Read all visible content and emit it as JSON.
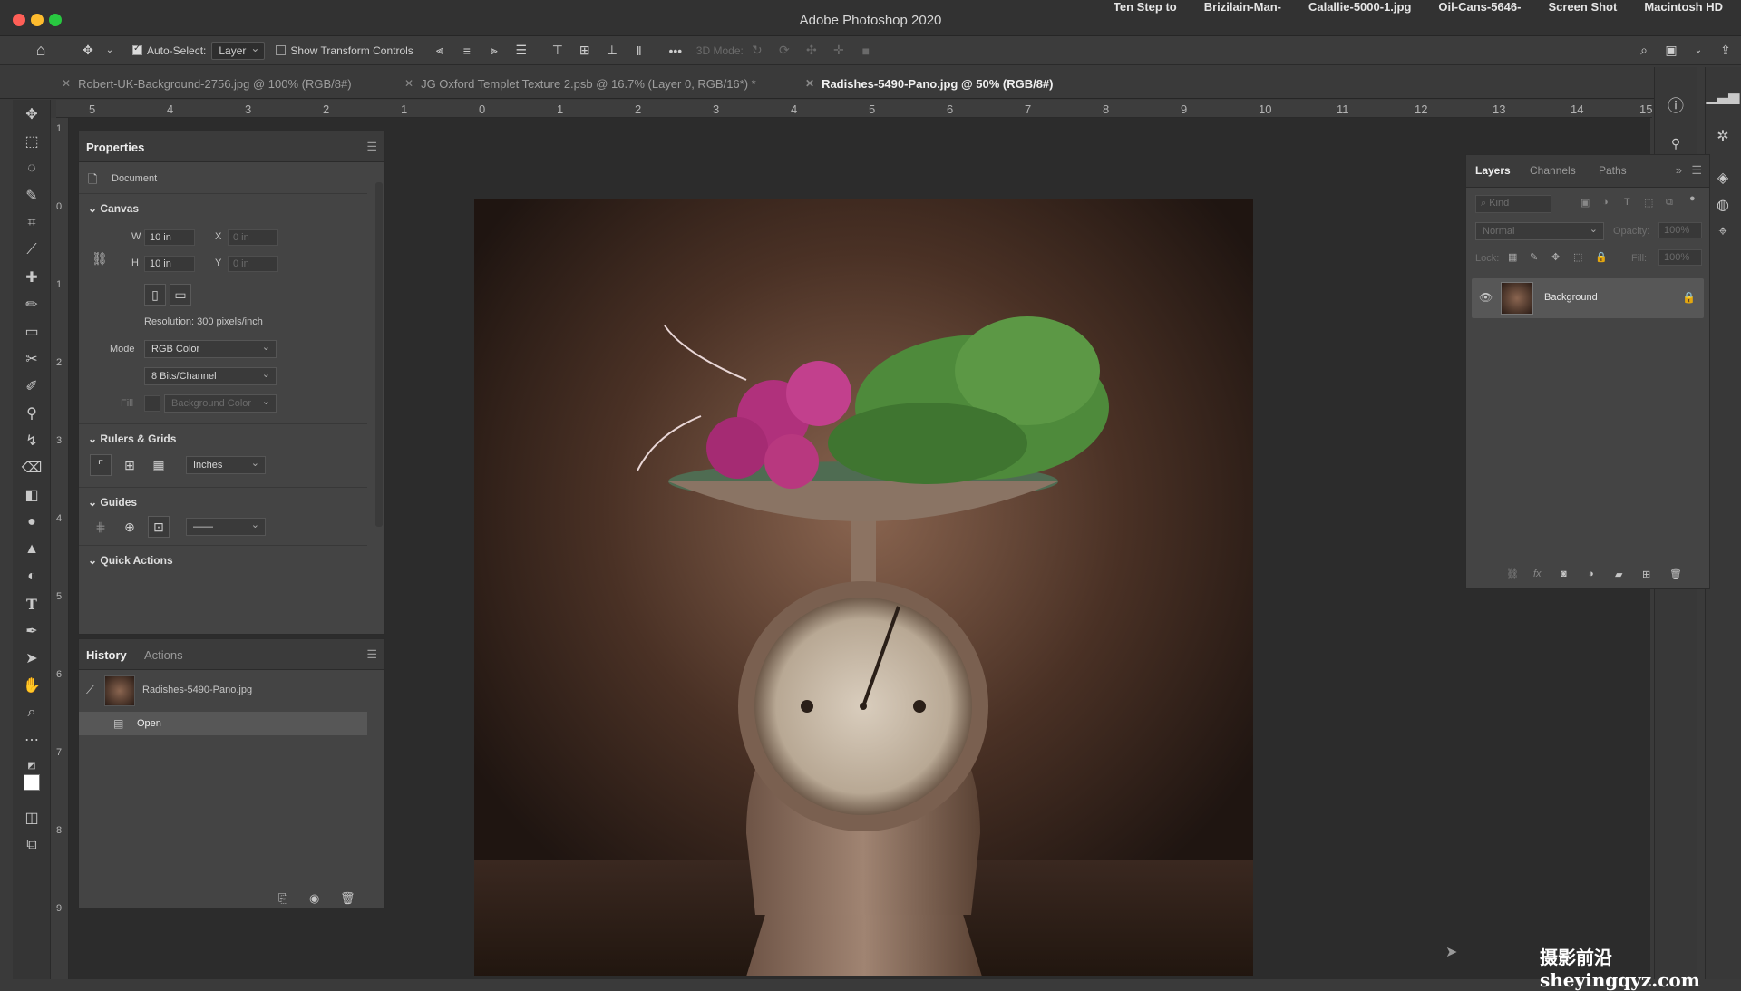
{
  "window": {
    "title": "Adobe Photoshop 2020",
    "desktop_labels": [
      "Ten Step to",
      "Brizilain-Man-",
      "Calallie-5000-1.jpg",
      "Oil-Cans-5646-",
      "Screen Shot",
      "Macintosh HD"
    ]
  },
  "options_bar": {
    "auto_select_label": "Auto-Select:",
    "auto_select_value": "Layer",
    "show_transform_label": "Show Transform Controls",
    "mode_3d_label": "3D Mode:",
    "more_label": "•••"
  },
  "tabs": [
    {
      "label": "Robert-UK-Background-2756.jpg @ 100% (RGB/8#)",
      "active": false
    },
    {
      "label": "JG Oxford Templet Texture 2.psb @ 16.7% (Layer 0, RGB/16*) *",
      "active": false
    },
    {
      "label": "Radishes-5490-Pano.jpg @ 50% (RGB/8#)",
      "active": true
    }
  ],
  "ruler": {
    "h_ticks": [
      "5",
      "4",
      "3",
      "2",
      "1",
      "0",
      "1",
      "2",
      "3",
      "4",
      "5",
      "6",
      "7",
      "8",
      "9",
      "10",
      "11",
      "12",
      "13",
      "14",
      "15"
    ],
    "v_ticks": [
      "1",
      "0",
      "1",
      "2",
      "3",
      "4",
      "5",
      "6",
      "7",
      "8",
      "9"
    ]
  },
  "properties": {
    "tab": "Properties",
    "document_label": "Document",
    "canvas_section": "Canvas",
    "w_label": "W",
    "w_value": "10 in",
    "h_label": "H",
    "h_value": "10 in",
    "x_label": "X",
    "x_value": "0 in",
    "y_label": "Y",
    "y_value": "0 in",
    "resolution": "Resolution: 300 pixels/inch",
    "mode_label": "Mode",
    "mode_value": "RGB Color",
    "bits_value": "8 Bits/Channel",
    "fill_label": "Fill",
    "fill_value": "Background Color",
    "rulers_section": "Rulers & Grids",
    "units_value": "Inches",
    "guides_section": "Guides",
    "quick_actions_section": "Quick Actions"
  },
  "history": {
    "tabs": [
      "History",
      "Actions"
    ],
    "snapshot_label": "Radishes-5490-Pano.jpg",
    "step_label": "Open"
  },
  "layers": {
    "tabs": [
      "Layers",
      "Channels",
      "Paths"
    ],
    "kind_placeholder": "Kind",
    "blend_mode": "Normal",
    "opacity_label": "Opacity:",
    "opacity_value": "100%",
    "lock_label": "Lock:",
    "fill_label": "Fill:",
    "fill_value": "100%",
    "layer_name": "Background"
  },
  "watermark": "摄影前沿 sheyingqyz.com",
  "colors": {
    "accent": "#3c3c3c",
    "red": "#ff5f57",
    "yellow": "#febc2e",
    "green": "#28c840"
  }
}
